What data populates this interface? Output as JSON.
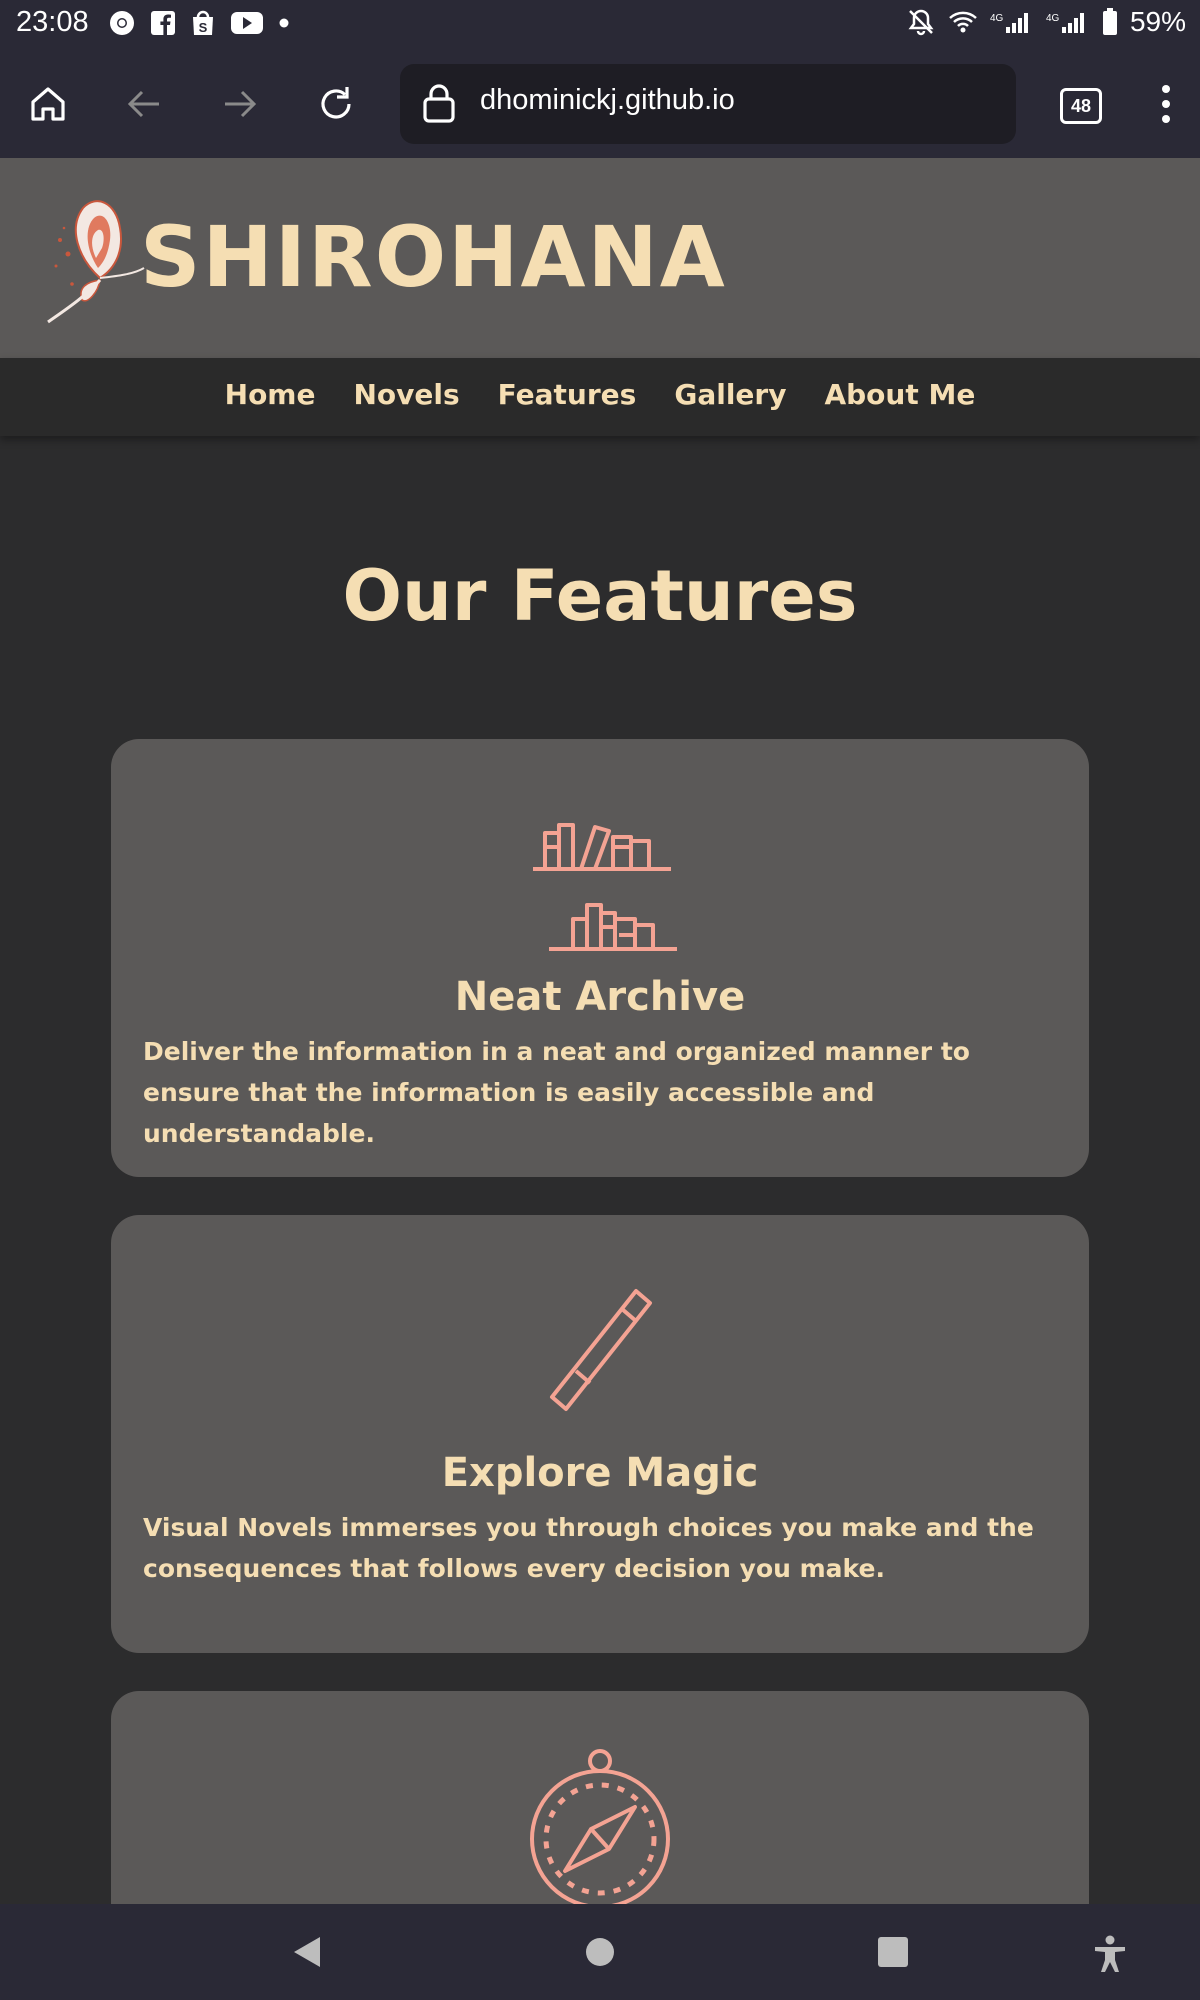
{
  "status_bar": {
    "time": "23:08",
    "battery": "59%",
    "left_icons": [
      "chrome-icon",
      "facebook-icon",
      "shop-icon",
      "youtube-icon",
      "dot-icon"
    ],
    "right_icons": [
      "mute-icon",
      "wifi-icon",
      "signal-4g-icon",
      "signal-4g-icon",
      "battery-icon"
    ],
    "network_label": "4G"
  },
  "browser": {
    "url": "dhominickj.github.io",
    "tab_count": "48"
  },
  "site": {
    "brand": "SHIROHANA",
    "nav": [
      "Home",
      "Novels",
      "Features",
      "Gallery",
      "About Me"
    ]
  },
  "main": {
    "title": "Our Features",
    "features": [
      {
        "title": "Neat Archive",
        "description": "Deliver the information in a neat and organized manner to ensure that the information is easily accessible and understandable.",
        "icon": "bookshelf-icon"
      },
      {
        "title": "Explore Magic",
        "description": "Visual Novels immerses you through choices you make and the consequences that follows every decision you make.",
        "icon": "magic-wand-icon"
      },
      {
        "title": "",
        "description": "",
        "icon": "compass-icon"
      }
    ]
  },
  "colors": {
    "accent": "#f5deb3",
    "icon": "#f4a393",
    "card": "#5b5958",
    "background": "#2c2c2d"
  }
}
